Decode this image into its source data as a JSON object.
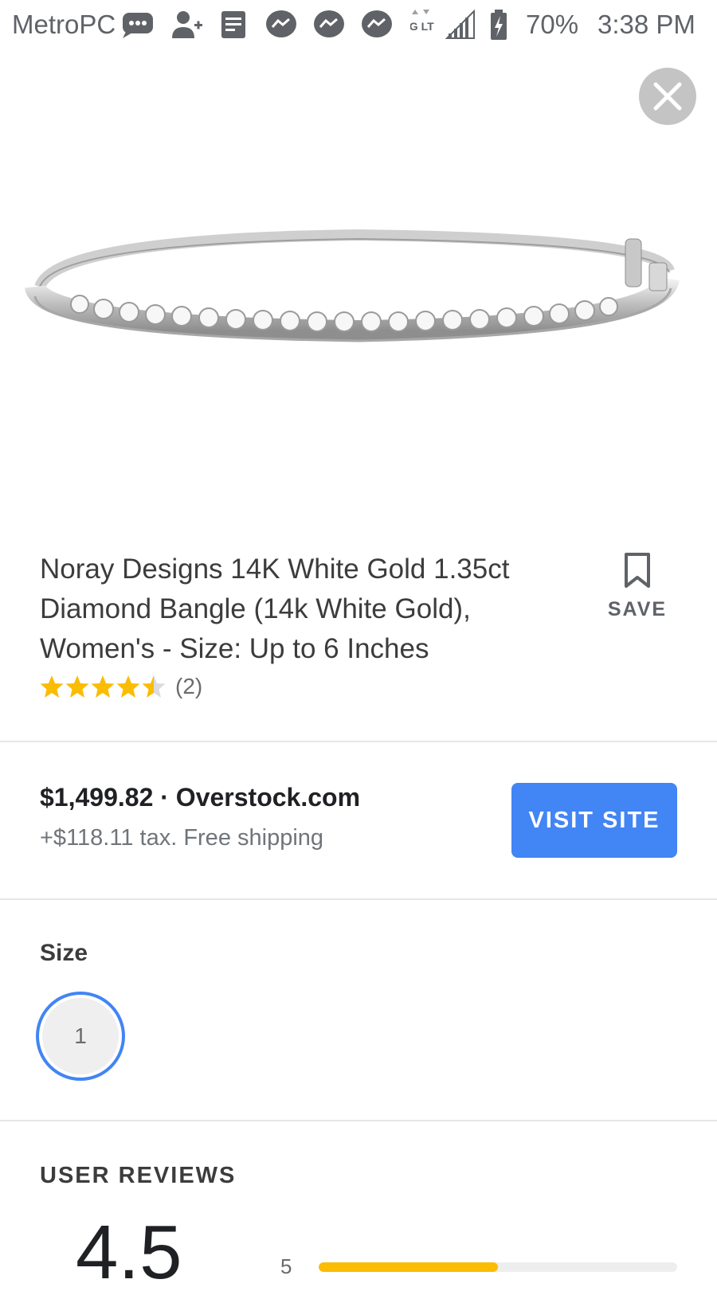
{
  "status_bar": {
    "carrier": "MetroPCS",
    "network": "4G LTE",
    "battery": "70%",
    "time": "3:38 PM",
    "notification_icons": [
      "message-bubble-icon",
      "add-contact-icon",
      "note-icon",
      "messenger-icon",
      "messenger-icon",
      "messenger-icon"
    ],
    "system_icons": [
      "data-arrows-icon",
      "signal-icon",
      "battery-charging-icon"
    ]
  },
  "product": {
    "title": "Noray Designs 14K White Gold 1.35ct Diamond Bangle (14k White Gold), Women's - Size: Up to 6 Inches",
    "rating": 4.5,
    "rating_count": "(2)",
    "save_label": "SAVE"
  },
  "offer": {
    "price_line": "$1,499.82 · Overstock.com",
    "tax_line": "+$118.11 tax. Free shipping",
    "visit_label": "VISIT SITE"
  },
  "size": {
    "label": "Size",
    "selected": "1"
  },
  "reviews": {
    "heading": "USER REVIEWS",
    "average": "4.5",
    "bars": [
      {
        "stars": "5",
        "fraction": 0.5
      }
    ]
  },
  "colors": {
    "accent": "#4285f4",
    "star": "#fbbc04",
    "close_button": "#c4c4c4"
  }
}
